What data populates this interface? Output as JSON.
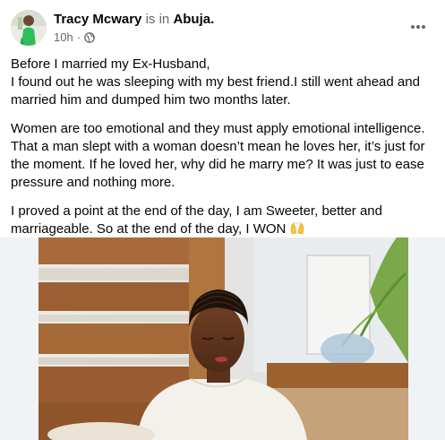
{
  "post": {
    "author": "Tracy Mcwary",
    "location_prefix": "is in",
    "location": "Abuja.",
    "time": "10h",
    "separator": "·",
    "audience_icon": "globe-icon",
    "more_icon": "more-horizontal-icon",
    "paragraphs": {
      "p1_line1": "Before I married my Ex-Husband,",
      "p1_line2": "I found out he was sleeping with my best friend.I still went ahead and married him and dumped him two months later.",
      "p2": "Women are too emotional and they must apply emotional intelligence. That a man slept with a woman doesn’t mean he loves her, it’s just for the moment. If he loved her, why did he marry me? It was just to ease pressure and nothing more.",
      "p3": "I proved a point at the end of the day, I am Sweeter, better and marriageable. So at the end of the day, I WON",
      "p3_emoji": "raising-hands-emoji"
    }
  },
  "colors": {
    "text": "#050505",
    "secondary": "#65676b",
    "background": "#ffffff",
    "page": "#f0f2f5"
  }
}
